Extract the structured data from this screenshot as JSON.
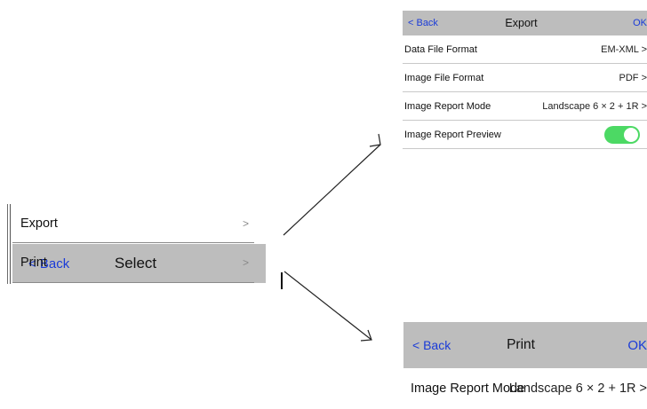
{
  "select_screen": {
    "back_label": "< Back",
    "title": "Select",
    "items": [
      {
        "label": "Export",
        "chevron": ">"
      },
      {
        "label": "Print",
        "chevron": ">"
      }
    ]
  },
  "export_screen": {
    "back_label": "< Back",
    "title": "Export",
    "ok_label": "OK",
    "rows": [
      {
        "label": "Data File Format",
        "value": "EM-XML >"
      },
      {
        "label": "Image File Format",
        "value": "PDF >"
      },
      {
        "label": "Image Report Mode",
        "value": "Landscape 6 × 2 + 1R >"
      },
      {
        "label": "Image Report Preview",
        "toggle_on": true
      }
    ]
  },
  "print_screen": {
    "back_label": "< Back",
    "title": "Print",
    "ok_label": "OK",
    "rows": [
      {
        "label": "Image Report Mode",
        "value": "Landscape 6 × 2 + 1R >"
      }
    ]
  },
  "colors": {
    "bar": "#bdbdbd",
    "link": "#1a3bd8",
    "toggle": "#4cd964"
  },
  "icons": [
    "chevron-right-icon",
    "arrow-icon",
    "toggle-switch"
  ]
}
